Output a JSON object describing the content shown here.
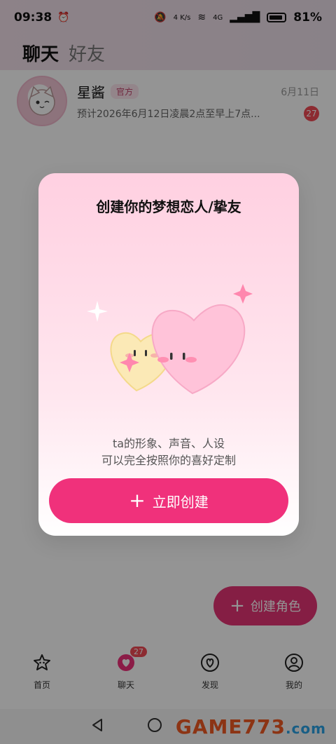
{
  "status_bar": {
    "time": "09:38",
    "network_speed": "4 K/s",
    "signal": "4G",
    "battery_percent": "81%"
  },
  "header": {
    "tabs": [
      {
        "label": "聊天",
        "active": true
      },
      {
        "label": "好友",
        "active": false
      }
    ]
  },
  "chat_list": [
    {
      "name": "星酱",
      "badge": "官方",
      "date": "6月11日",
      "preview": "预计2026年6月12日凌晨2点至早上7点...",
      "unread": "27"
    }
  ],
  "fab": {
    "label": "创建角色"
  },
  "modal": {
    "title": "创建你的梦想恋人/挚友",
    "desc_line1": "ta的形象、声音、人设",
    "desc_line2": "可以完全按照你的喜好定制",
    "button_label": "立即创建"
  },
  "bottom_nav": {
    "items": [
      {
        "label": "首页",
        "icon": "home-star-icon"
      },
      {
        "label": "聊天",
        "icon": "chat-heart-icon",
        "badge": "27"
      },
      {
        "label": "发现",
        "icon": "discover-heart-icon"
      },
      {
        "label": "我的",
        "icon": "profile-icon"
      }
    ]
  },
  "watermark": {
    "text": "GAME773",
    "suffix": ".com"
  },
  "colors": {
    "accent": "#f0317b",
    "badge_red": "#f24a55",
    "modal_bg_top": "#ffd0e1"
  }
}
